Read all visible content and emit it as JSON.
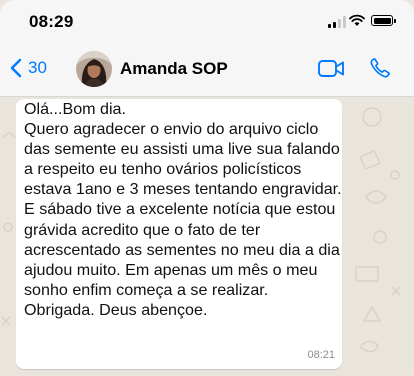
{
  "status_bar": {
    "time": "08:29"
  },
  "header": {
    "back_count": "30",
    "contact_name": "Amanda SOP"
  },
  "message": {
    "text": "Olá...Bom dia.\nQuero agradecer o envio do arquivo ciclo das semente eu assisti uma live sua falando a respeito eu tenho ovários policísticos estava 1ano e 3 meses tentando engravidar. E sábado tive a excelente notícia que estou grávida acredito que o fato de ter acrescentado as sementes no meu dia a dia ajudou muito. Em apenas um mês o meu sonho enfim começa a se realizar. Obrigada. Deus abençoe.",
    "time": "08:21"
  },
  "colors": {
    "accent": "#007aff",
    "chat_background": "#e9e4dc",
    "bubble": "#ffffff"
  },
  "icons": [
    "signal-icon",
    "wifi-icon",
    "battery-icon",
    "chevron-left-icon",
    "video-call-icon",
    "phone-icon"
  ]
}
